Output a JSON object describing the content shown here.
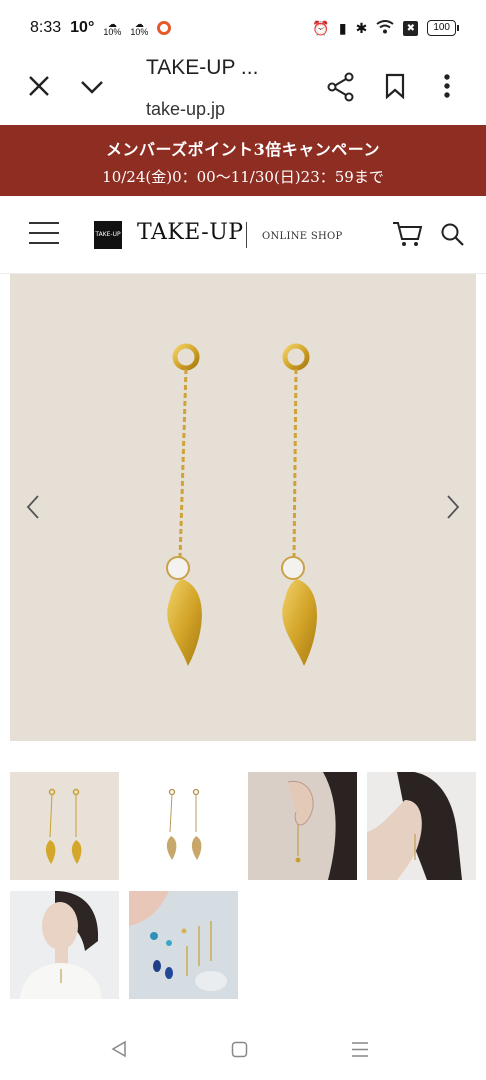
{
  "status_bar": {
    "time": "8:33",
    "temperature": "10°",
    "weather_1": "10%",
    "weather_2": "10%",
    "battery": "100",
    "notif_badge": "✖"
  },
  "browser": {
    "title": "TAKE-UP ...",
    "url": "take-up.jp"
  },
  "promo": {
    "line1": "メンバーズポイント3倍キャンペーン",
    "line2": "10/24(金)0：00〜11/30(日)23：59まで"
  },
  "site": {
    "logo_mark": "TAKE-UP",
    "logo_text": "TAKE-UP",
    "logo_sub": "ONLINE SHOP"
  },
  "colors": {
    "banner_bg": "#8e2d22",
    "image_bg": "#e5dfd6",
    "gold": "#d4a62a"
  },
  "icons": {
    "close": "close-icon",
    "tabs": "chevron-down-icon",
    "share": "share-icon",
    "bookmark": "bookmark-icon",
    "more": "more-vert-icon",
    "menu": "hamburger-icon",
    "cart": "cart-icon",
    "search": "search-icon"
  },
  "gallery": {
    "thumbnails": [
      "earrings-on-beige",
      "earrings-on-white",
      "model-ear-closeup",
      "model-side-profile",
      "model-wearing-necklace",
      "assorted-jewelry-on-blue"
    ]
  }
}
